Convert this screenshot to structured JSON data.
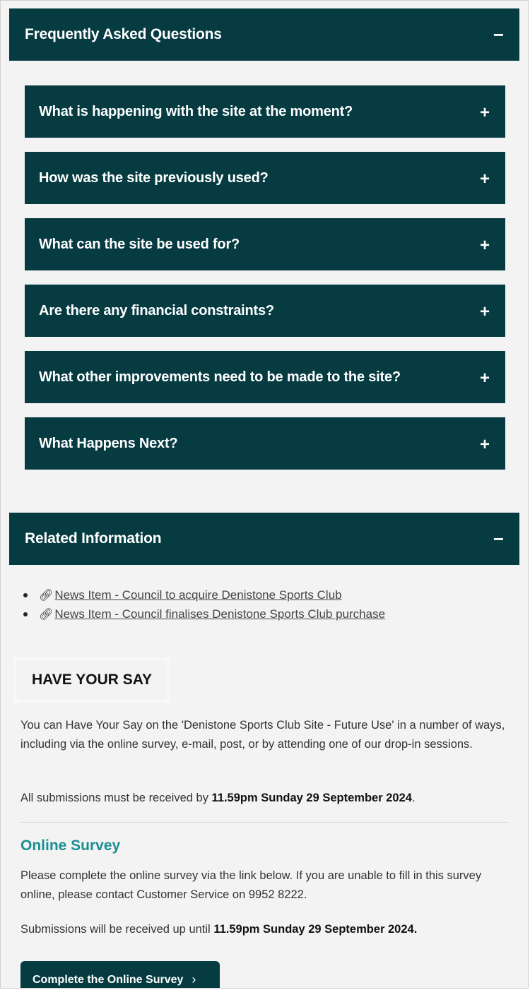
{
  "faq": {
    "title": "Frequently Asked Questions",
    "toggle": "−",
    "items": [
      {
        "question": "What is happening with the site at the moment?",
        "toggle": "+"
      },
      {
        "question": "How was the site previously used?",
        "toggle": "+"
      },
      {
        "question": "What can the site be used for?",
        "toggle": "+"
      },
      {
        "question": "Are there any financial constraints?",
        "toggle": "+"
      },
      {
        "question": "What other improvements need to be made to the site?",
        "toggle": "+"
      },
      {
        "question": "What Happens Next?",
        "toggle": "+"
      }
    ]
  },
  "related": {
    "title": "Related Information",
    "toggle": "−",
    "links": [
      {
        "label": "News Item - Council to acquire Denistone Sports Club",
        "icon": "link-icon"
      },
      {
        "label": "News Item - Council finalises Denistone Sports Club purchase",
        "icon": "link-icon"
      }
    ]
  },
  "have_your_say": {
    "title": "HAVE YOUR SAY",
    "intro": "You can Have Your Say on the 'Denistone Sports Club Site - Future Use' in a number of ways, including via the online survey, e-mail, post, or by attending one of our drop-in sessions.",
    "deadline_prefix": "All submissions must be received by ",
    "deadline_bold": "11.59pm Sunday 29 September 2024",
    "deadline_suffix": "."
  },
  "online_survey": {
    "title": "Online Survey",
    "intro": "Please complete the online survey via the link below. If you are unable to fill in this survey online, please contact Customer Service on 9952 8222.",
    "deadline_prefix": "Submissions will be received up until ",
    "deadline_bold": "11.59pm Sunday 29 September 2024.",
    "button_label": "Complete the Online Survey",
    "button_chevron": "›"
  },
  "colors": {
    "header_bg": "#063b41",
    "accent": "#1b8f92"
  }
}
